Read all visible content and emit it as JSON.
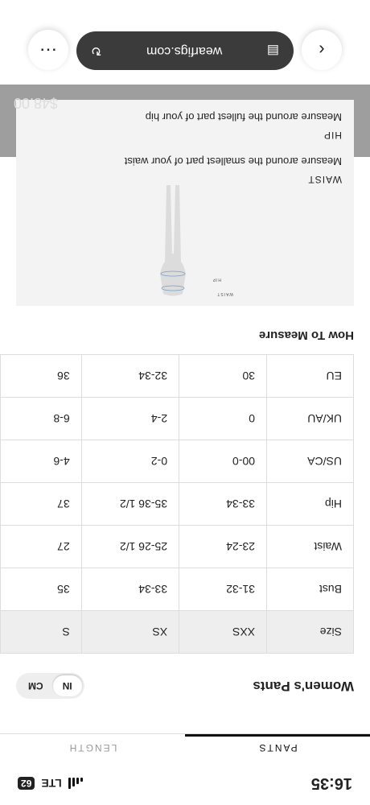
{
  "status_bar": {
    "time": "16:35",
    "network": "LTE",
    "battery": "62"
  },
  "tabs": [
    {
      "label": "PANTS"
    },
    {
      "label": "LENGTH"
    }
  ],
  "section": {
    "title": "Women's Pants",
    "unit_options": [
      "IN",
      "CM"
    ],
    "selected_unit": "IN"
  },
  "size_table": {
    "rows": [
      {
        "label": "Size",
        "values": [
          "XXS",
          "XS",
          "S"
        ]
      },
      {
        "label": "Bust",
        "values": [
          "31-32",
          "33-34",
          "35"
        ]
      },
      {
        "label": "Waist",
        "values": [
          "23-24",
          "25-26 1/2",
          "27"
        ]
      },
      {
        "label": "Hip",
        "values": [
          "33-34",
          "35-36 1/2",
          "37"
        ]
      },
      {
        "label": "US/CA",
        "values": [
          "00-0",
          "0-2",
          "4-6"
        ]
      },
      {
        "label": "UK/AU",
        "values": [
          "0",
          "2-4",
          "6-8"
        ]
      },
      {
        "label": "EU",
        "values": [
          "30",
          "32-34",
          "36"
        ]
      }
    ]
  },
  "how_to_measure": {
    "title": "How To Measure",
    "figure_labels": {
      "waist": "WAIST",
      "hip": "HIP"
    },
    "items": [
      {
        "label": "WAIST",
        "text": "Measure around the smallest part of your waist"
      },
      {
        "label": "HIP",
        "text": "Measure around the fullest part of your hip"
      }
    ]
  },
  "product": {
    "price": "$48.00"
  },
  "browser": {
    "url": "wearfigs.com",
    "back_icon": "chevron-left-icon",
    "more_icon": "more-icon"
  },
  "colors": {
    "accent": "#111111",
    "table_header_bg": "#eeeeee",
    "url_bar_bg": "#3b3b3b",
    "card_bg": "#f3f3f3"
  }
}
